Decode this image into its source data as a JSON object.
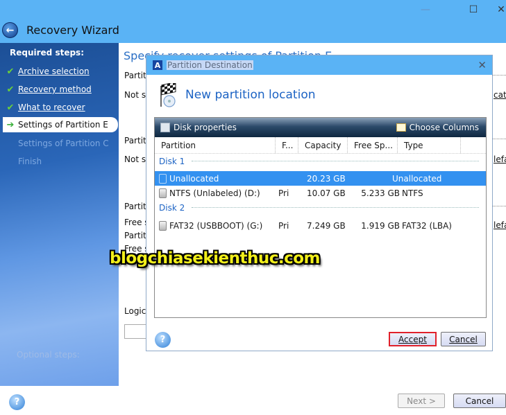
{
  "window": {
    "title": "Recovery Wizard",
    "controls": {
      "minimize": "—",
      "maximize": "☐",
      "close": "✕"
    }
  },
  "sidebar": {
    "required_heading": "Required steps:",
    "items": [
      {
        "label": "Archive selection",
        "state": "done",
        "icon": "check"
      },
      {
        "label": "Recovery method",
        "state": "done",
        "icon": "check"
      },
      {
        "label": "What to recover",
        "state": "done",
        "icon": "check"
      },
      {
        "label": "Settings of Partition E",
        "state": "active",
        "icon": "arrow-right"
      },
      {
        "label": "Settings of Partition C",
        "state": "disabled"
      },
      {
        "label": "Finish",
        "state": "disabled"
      }
    ],
    "optional_heading": "Optional steps:"
  },
  "main": {
    "title": "Specify recover settings of Partition E",
    "labels": [
      "Partiti",
      "Not se",
      "Partiti",
      "Not se",
      "Partiti",
      "Free s",
      "Partiti",
      "Free s",
      "Logica"
    ],
    "links": [
      "cati",
      "lefa",
      "lefa"
    ]
  },
  "footer": {
    "help": "?",
    "next_label": "Next >",
    "next_mnemonic": "N",
    "cancel_label": "Cancel",
    "cancel_mnemonic": "C"
  },
  "dialog": {
    "title": "Partition Destination",
    "logo": "A",
    "close": "✕",
    "heading": "New partition location",
    "toolbar": {
      "disk_properties": "Disk properties",
      "choose_columns": "Choose Columns"
    },
    "columns": [
      "Partition",
      "F...",
      "Capacity",
      "Free Sp...",
      "Type"
    ],
    "groups": [
      {
        "name": "Disk 1",
        "rows": [
          {
            "partition": "Unallocated",
            "flags": "",
            "capacity": "20.23 GB",
            "free": "",
            "type": "Unallocated",
            "selected": true
          },
          {
            "partition": "NTFS (Unlabeled) (D:)",
            "flags": "Pri",
            "capacity": "10.07 GB",
            "free": "5.233 GB",
            "type": "NTFS",
            "selected": false
          }
        ]
      },
      {
        "name": "Disk 2",
        "rows": [
          {
            "partition": "FAT32 (USBBOOT) (G:)",
            "flags": "Pri",
            "capacity": "7.249 GB",
            "free": "1.919 GB",
            "type": "FAT32 (LBA)",
            "selected": false
          }
        ]
      }
    ],
    "help": "?",
    "accept_label": "Accept",
    "cancel_label": "Cancel",
    "highlight_color": "#e0202a"
  },
  "watermark": "blogchiasekienthuc.com"
}
